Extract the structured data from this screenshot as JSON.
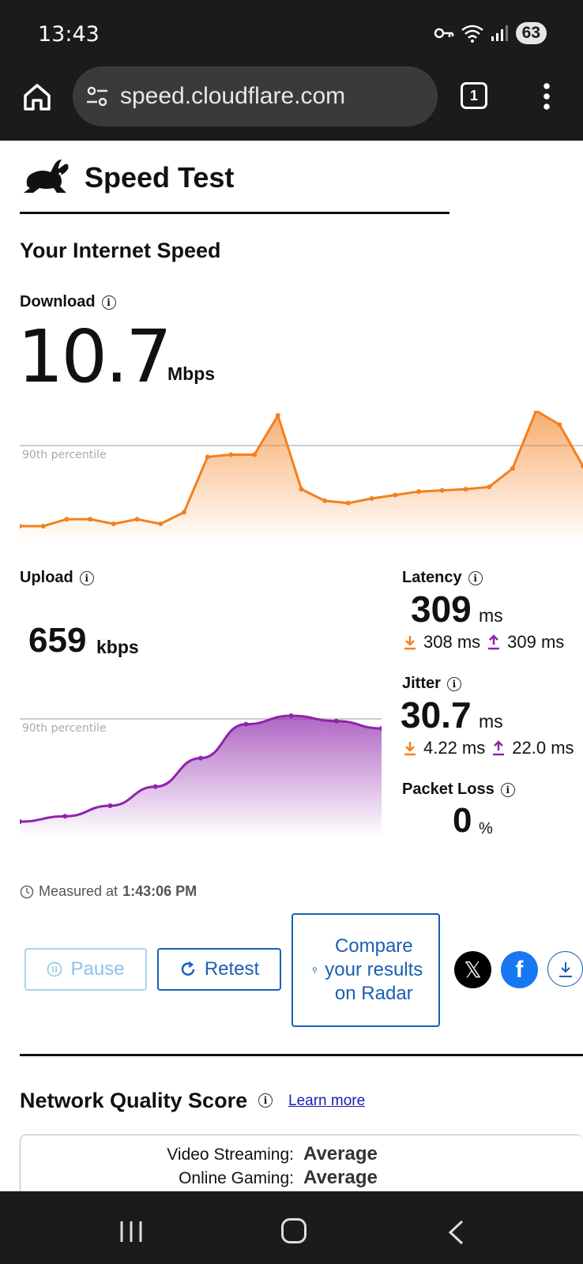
{
  "status_bar": {
    "time": "13:43",
    "battery": "63",
    "icons": [
      "key-icon",
      "wifi-icon",
      "signal-icon"
    ]
  },
  "browser": {
    "url": "speed.cloudflare.com",
    "tab_count": "1"
  },
  "header": {
    "brand": "Speed Test"
  },
  "speed": {
    "heading": "Your Internet Speed",
    "download": {
      "label": "Download",
      "value": "10.7",
      "unit": "Mbps"
    },
    "upload": {
      "label": "Upload",
      "value": "659",
      "unit": "kbps"
    },
    "percentile_label": "90th percentile",
    "latency": {
      "label": "Latency",
      "value": "309",
      "unit": "ms",
      "down": "308 ms",
      "up": "309 ms"
    },
    "jitter": {
      "label": "Jitter",
      "value": "30.7",
      "unit": "ms",
      "down": "4.22 ms",
      "up": "22.0 ms"
    },
    "packet_loss": {
      "label": "Packet Loss",
      "value": "0",
      "unit": "%"
    }
  },
  "measured": {
    "prefix": "Measured at",
    "time": "1:43:06 PM"
  },
  "actions": {
    "pause": "Pause",
    "retest": "Retest",
    "compare": "Compare your results on Radar"
  },
  "network_quality": {
    "title": "Network Quality Score",
    "learn_more": "Learn more",
    "rows": [
      {
        "label": "Video Streaming:",
        "value": "Average"
      },
      {
        "label": "Online Gaming:",
        "value": "Average"
      }
    ]
  },
  "colors": {
    "download": "#f38020",
    "upload": "#8e24aa",
    "link": "#1a5fb4"
  },
  "charts": {
    "download_series": [
      0.0,
      0.0,
      0.06,
      0.06,
      0.02,
      0.06,
      0.02,
      0.12,
      0.6,
      0.62,
      0.62,
      0.96,
      0.32,
      0.22,
      0.2,
      0.24,
      0.27,
      0.3,
      0.31,
      0.32,
      0.34,
      0.5,
      1.0,
      0.88,
      0.52
    ],
    "upload_series": [
      0.0,
      0.05,
      0.15,
      0.33,
      0.6,
      0.92,
      1.0,
      0.95,
      0.88
    ]
  }
}
